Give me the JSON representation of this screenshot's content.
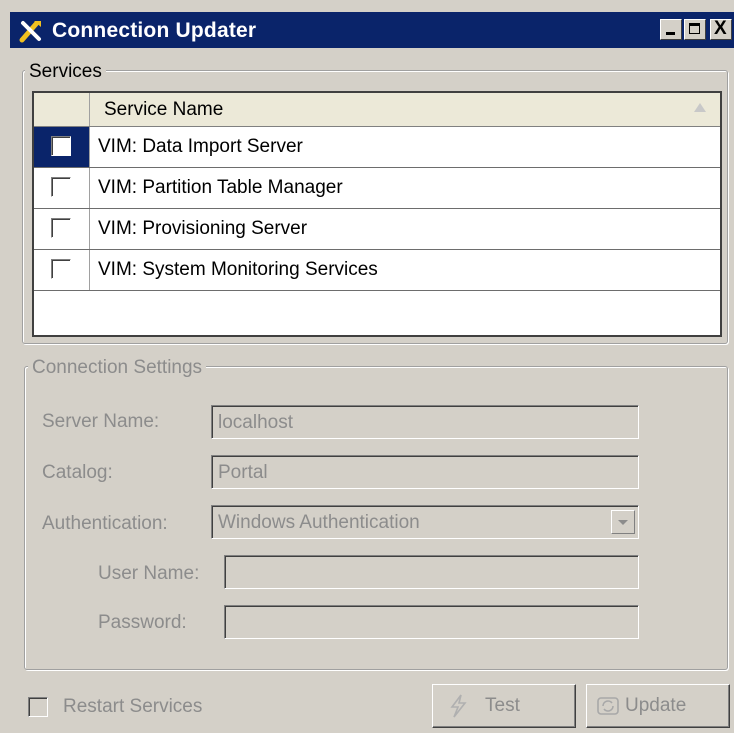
{
  "window": {
    "title": "Connection Updater",
    "icon": "tools-icon",
    "controls": [
      "minimize-icon",
      "maximize-icon",
      "close-icon"
    ],
    "close_glyph": "X"
  },
  "services": {
    "group_label": "Services",
    "column_header": "Service Name",
    "rows": [
      {
        "label": "VIM: Data Import Server",
        "checked": false,
        "selected": true
      },
      {
        "label": "VIM: Partition Table Manager",
        "checked": false,
        "selected": false
      },
      {
        "label": "VIM: Provisioning Server",
        "checked": false,
        "selected": false
      },
      {
        "label": "VIM: System Monitoring Services",
        "checked": false,
        "selected": false
      }
    ]
  },
  "connection": {
    "group_label": "Connection Settings",
    "server_name": {
      "label": "Server Name:",
      "value": "localhost"
    },
    "catalog": {
      "label": "Catalog:",
      "value": "Portal"
    },
    "authentication": {
      "label": "Authentication:",
      "value": "Windows Authentication"
    },
    "user_name": {
      "label": "User Name:",
      "value": ""
    },
    "password": {
      "label": "Password:",
      "value": ""
    }
  },
  "footer": {
    "restart_label": "Restart Services",
    "restart_checked": false,
    "test_label": "Test",
    "update_label": "Update"
  },
  "colors": {
    "titlebar": "#0a246a",
    "window_bg": "#d4d0c8",
    "disabled_text": "#8c8c8c"
  }
}
